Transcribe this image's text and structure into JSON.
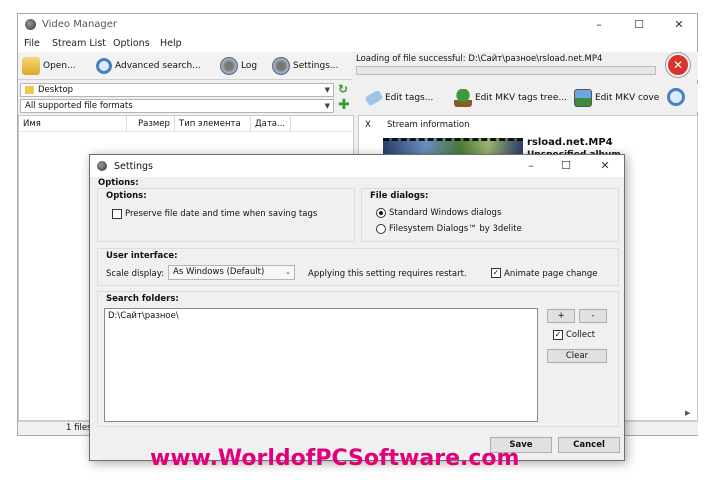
{
  "window": {
    "title": "Video Manager",
    "controls": [
      "–",
      "☐",
      "✕"
    ]
  },
  "menu": [
    "File",
    "Stream List",
    "Options",
    "Help"
  ],
  "toolbar": {
    "open": "Open...",
    "advanced_search": "Advanced search...",
    "log": "Log",
    "settings": "Settings..."
  },
  "status": {
    "message": "Loading of file successful: D:\\Сайт\\разное\\rsload.net.MP4"
  },
  "left": {
    "location": "Desktop",
    "filter": "All supported file formats",
    "columns": [
      "Имя",
      "Размер",
      "Тип элемента",
      "Дата..."
    ],
    "footer": "1 files"
  },
  "right": {
    "tabs": [
      "Edit tags...",
      "Edit MKV tags tree...",
      "Edit MKV cove"
    ],
    "columns": [
      "X",
      "Stream information"
    ],
    "file_name": "rsload.net.MP4",
    "album": "Unspecified album"
  },
  "dialog": {
    "title": "Settings",
    "options_header": "Options:",
    "options_group": {
      "label": "Options:",
      "preserve_date": "Preserve file date and time when saving tags"
    },
    "file_dialogs": {
      "label": "File dialogs:",
      "standard": "Standard Windows dialogs",
      "filesystem": "Filesystem Dialogs™ by 3delite"
    },
    "ui": {
      "label": "User interface:",
      "scale_label": "Scale display:",
      "scale_value": "As Windows (Default)",
      "restart_note": "Applying this setting requires restart.",
      "animate": "Animate page change"
    },
    "search": {
      "label": "Search folders:",
      "folder": "D:\\Сайт\\разное\\",
      "add": "+",
      "remove": "-",
      "collect": "Collect",
      "clear": "Clear"
    },
    "save": "Save",
    "cancel": "Cancel"
  },
  "watermark": "www.WorldofPCSoftware.com",
  "colors": {
    "close_red": "#d9342b",
    "watermark": "#e0007a",
    "progress_green": "#3da13d"
  }
}
